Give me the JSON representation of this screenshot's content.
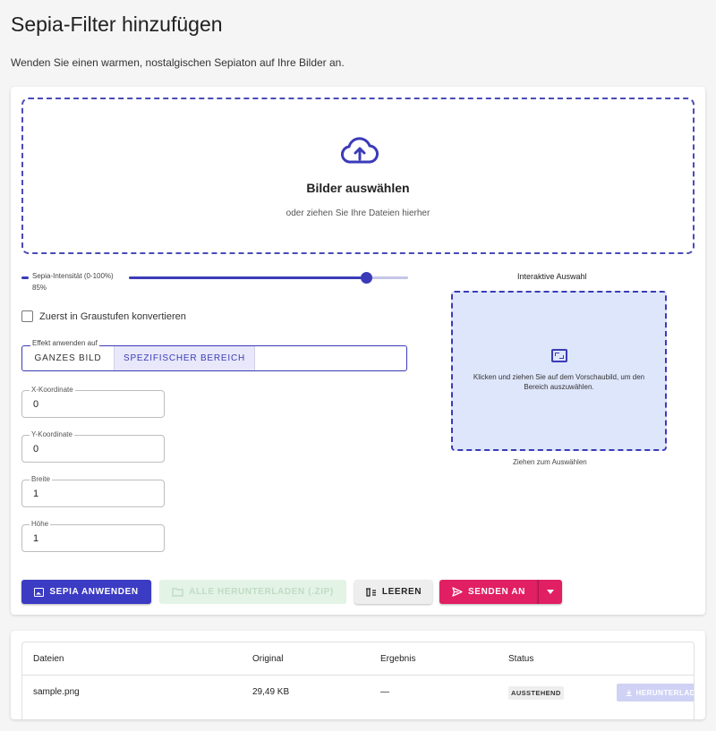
{
  "page": {
    "title": "Sepia-Filter hinzufügen",
    "description": "Wenden Sie einen warmen, nostalgischen Sepiaton auf Ihre Bilder an."
  },
  "dropzone": {
    "icon": "cloud-upload-icon",
    "title": "Bilder auswählen",
    "subtitle": "oder ziehen Sie Ihre Dateien hierher"
  },
  "intensity": {
    "label": "Sepia-Intensität (0-100%)",
    "value_text": "85%",
    "value": 85,
    "min": 0,
    "max": 100
  },
  "grayscale": {
    "label": "Zuerst in Graustufen konvertieren",
    "checked": false
  },
  "apply_mode": {
    "legend": "Effekt anwenden auf",
    "options": [
      "GANZES BILD",
      "SPEZIFISCHER BEREICH"
    ],
    "selected": "SPEZIFISCHER BEREICH"
  },
  "fields": {
    "x": {
      "label": "X-Koordinate",
      "value": "0"
    },
    "y": {
      "label": "Y-Koordinate",
      "value": "0"
    },
    "width": {
      "label": "Breite",
      "value": "1"
    },
    "height": {
      "label": "Höhe",
      "value": "1"
    }
  },
  "preview": {
    "title": "Interaktive Auswahl",
    "text": "Klicken und ziehen Sie auf dem Vorschaubild, um den Bereich auszuwählen.",
    "caption": "Ziehen zum Auswählen",
    "icon": "crop-area-icon"
  },
  "actions": {
    "apply": "SEPIA ANWENDEN",
    "download_all": "ALLE HERUNTERLADEN (.ZIP)",
    "clear": "LEEREN",
    "send": "SENDEN AN"
  },
  "files_table": {
    "headers": [
      "Dateien",
      "Original",
      "Ergebnis",
      "Status"
    ],
    "rows": [
      {
        "name": "sample.png",
        "original": "29,49 KB",
        "result": "—",
        "status": "AUSSTEHEND",
        "action": "HERUNTERLADEN"
      }
    ]
  },
  "colors": {
    "primary": "#3b3bc4",
    "accent": "#e11f63",
    "preview_bg": "#dee6fb"
  }
}
